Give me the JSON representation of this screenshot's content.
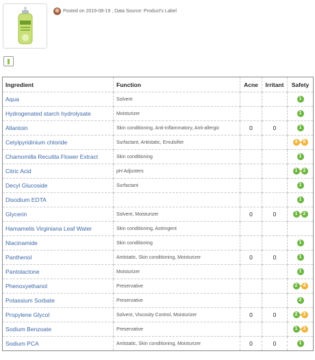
{
  "post": {
    "posted_on": "Posted on 2019-08-19 , Data Source: Product's Label"
  },
  "colors": {
    "safe": "#6ab53f",
    "moderate": "#f0b43c",
    "link": "#3a66a8"
  },
  "icons": {
    "avatar": "user-avatar",
    "product": "product-bottle-image",
    "toggle": "toggle-icon"
  },
  "table": {
    "headers": {
      "ingredient": "Ingredient",
      "function": "Function",
      "acne": "Acne",
      "irritant": "Irritant",
      "safety": "Safety"
    },
    "rows": [
      {
        "ingredient": "Aqua",
        "function": "Solvent",
        "acne": "",
        "irritant": "",
        "safety": [
          "1"
        ]
      },
      {
        "ingredient": "Hydrogenated starch hydrolysate",
        "function": "Moisturizer",
        "acne": "",
        "irritant": "",
        "safety": [
          "1"
        ]
      },
      {
        "ingredient": "Allantoin",
        "function": "Skin conditioning, Anti-inflammatory, Anti-allergic",
        "acne": "0",
        "irritant": "0",
        "safety": [
          "1"
        ]
      },
      {
        "ingredient": "Cetylpyridinium chloride",
        "function": "Surfactant, Antistatic, Emulsifier",
        "acne": "",
        "irritant": "",
        "safety": [
          "3",
          "5"
        ]
      },
      {
        "ingredient": "Chamomilla Recutita Flower Extract",
        "function": "Skin conditioning",
        "acne": "",
        "irritant": "",
        "safety": [
          "1"
        ]
      },
      {
        "ingredient": "Citric Acid",
        "function": "pH Adjusters",
        "acne": "",
        "irritant": "",
        "safety": [
          "1",
          "2"
        ]
      },
      {
        "ingredient": "Decyl Glucoside",
        "function": "Surfactant",
        "acne": "",
        "irritant": "",
        "safety": [
          "1"
        ]
      },
      {
        "ingredient": "Disodium EDTA",
        "function": "",
        "acne": "",
        "irritant": "",
        "safety": [
          "1"
        ]
      },
      {
        "ingredient": "Glycerin",
        "function": "Solvent, Moisturizer",
        "acne": "0",
        "irritant": "0",
        "safety": [
          "1",
          "2"
        ]
      },
      {
        "ingredient": "Hamamelis Virginiana Leaf Water",
        "function": "Skin conditioning, Astringent",
        "acne": "",
        "irritant": "",
        "safety": []
      },
      {
        "ingredient": "Niacinamide",
        "function": "Skin conditioning",
        "acne": "",
        "irritant": "",
        "safety": [
          "1"
        ]
      },
      {
        "ingredient": "Panthenol",
        "function": "Antistatic, Skin conditioning, Moisturizer",
        "acne": "0",
        "irritant": "0",
        "safety": [
          "1"
        ]
      },
      {
        "ingredient": "Pantolactone",
        "function": "Moisturizer",
        "acne": "",
        "irritant": "",
        "safety": [
          "1"
        ]
      },
      {
        "ingredient": "Phenoxyethanol",
        "function": "Preservative",
        "acne": "",
        "irritant": "",
        "safety": [
          "2",
          "4"
        ]
      },
      {
        "ingredient": "Potassium Sorbate",
        "function": "Preservative",
        "acne": "",
        "irritant": "",
        "safety": [
          "2"
        ]
      },
      {
        "ingredient": "Propylene Glycol",
        "function": "Solvent, Viscosity Control, Moisturizer",
        "acne": "0",
        "irritant": "0",
        "safety": [
          "2",
          "3"
        ]
      },
      {
        "ingredient": "Sodium Benzoate",
        "function": "Preservative",
        "acne": "",
        "irritant": "",
        "safety": [
          "1",
          "3"
        ]
      },
      {
        "ingredient": "Sodium PCA",
        "function": "Antistatic, Skin conditioning, Moisturizer",
        "acne": "0",
        "irritant": "0",
        "safety": [
          "1"
        ]
      }
    ]
  }
}
